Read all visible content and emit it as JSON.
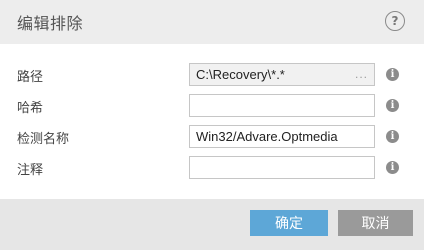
{
  "dialog": {
    "title": "编辑排除",
    "help_label": "?"
  },
  "fields": [
    {
      "label": "路径",
      "value": "C:\\Recovery\\*.*",
      "browse_label": "..."
    },
    {
      "label": "哈希",
      "value": ""
    },
    {
      "label": "检测名称",
      "value": "Win32/Advare.Optmedia"
    },
    {
      "label": "注释",
      "value": ""
    }
  ],
  "info_glyph": "i",
  "buttons": {
    "ok": "确定",
    "cancel": "取消"
  },
  "colors": {
    "header_bg": "#ededed",
    "footer_bg": "#e6e6e6",
    "primary_button": "#5da7d7",
    "secondary_button": "#9a9a9a",
    "info_icon": "#8c8c8c"
  }
}
